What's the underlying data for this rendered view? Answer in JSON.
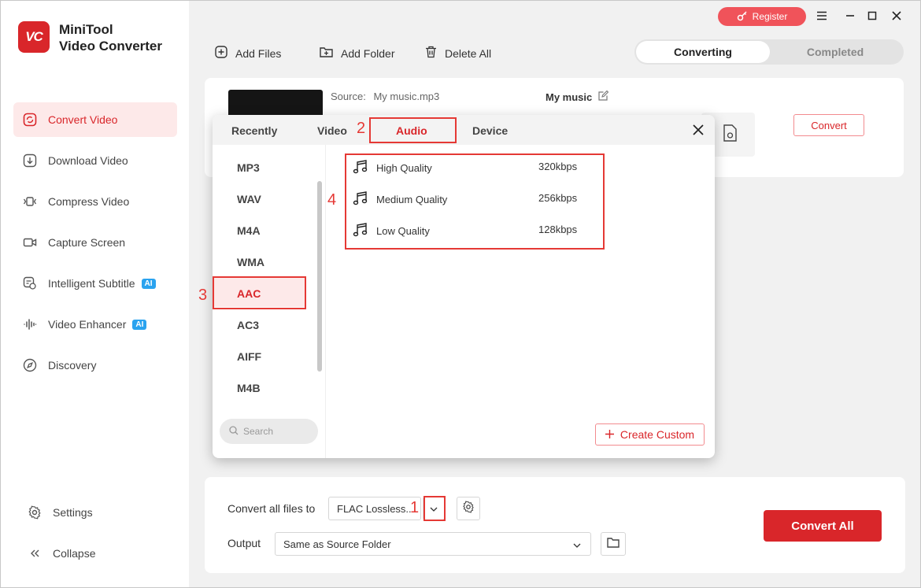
{
  "app": {
    "name_line1": "MiniTool",
    "name_line2": "Video Converter",
    "logo_text": "VC"
  },
  "sidebar": {
    "items": [
      {
        "label": "Convert Video",
        "icon": "convert-icon",
        "active": true
      },
      {
        "label": "Download Video",
        "icon": "download-icon"
      },
      {
        "label": "Compress Video",
        "icon": "compress-icon"
      },
      {
        "label": "Capture Screen",
        "icon": "camera-icon"
      },
      {
        "label": "Intelligent Subtitle",
        "icon": "subtitle-icon",
        "badge": "AI"
      },
      {
        "label": "Video Enhancer",
        "icon": "waveform-icon",
        "badge": "AI"
      },
      {
        "label": "Discovery",
        "icon": "compass-icon"
      }
    ],
    "settings_label": "Settings",
    "collapse_label": "Collapse"
  },
  "header": {
    "register_label": "Register"
  },
  "toolbar": {
    "add_files": "Add Files",
    "add_folder": "Add Folder",
    "delete_all": "Delete All"
  },
  "tabs": {
    "converting": "Converting",
    "completed": "Completed"
  },
  "file_card": {
    "source_label": "Source:",
    "source_value": "My music.mp3",
    "target_title": "My music",
    "convert_label": "Convert"
  },
  "popup": {
    "tabs": [
      "Recently",
      "Video",
      "Audio",
      "Device"
    ],
    "active_tab": "Audio",
    "formats": [
      "MP3",
      "WAV",
      "M4A",
      "WMA",
      "AAC",
      "AC3",
      "AIFF",
      "M4B"
    ],
    "selected_format": "AAC",
    "search_placeholder": "Search",
    "qualities": [
      {
        "name": "High Quality",
        "bitrate": "320kbps"
      },
      {
        "name": "Medium Quality",
        "bitrate": "256kbps"
      },
      {
        "name": "Low Quality",
        "bitrate": "128kbps"
      }
    ],
    "create_custom_label": "Create Custom"
  },
  "bottom": {
    "convert_all_label": "Convert all files to",
    "convert_all_value": "FLAC Lossless...",
    "output_label": "Output",
    "output_value": "Same as Source Folder",
    "convert_all_button": "Convert All"
  },
  "annotations": {
    "n1": "1",
    "n2": "2",
    "n3": "3",
    "n4": "4"
  },
  "colors": {
    "accent": "#d9262a",
    "annotation": "#e53935",
    "ai_badge": "#2aa3ef"
  }
}
